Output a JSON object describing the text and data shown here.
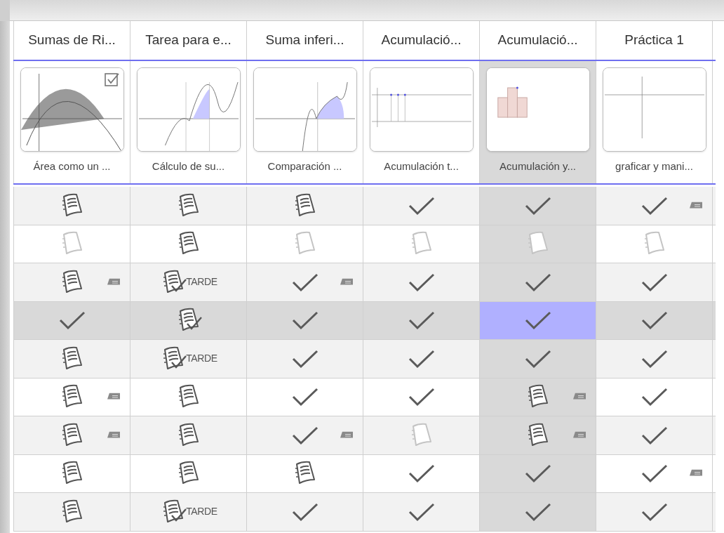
{
  "columns": [
    {
      "title": "Sumas de Ri...",
      "subtitle": "Área como un ...",
      "checked": true,
      "selected": false
    },
    {
      "title": "Tarea para e...",
      "subtitle": "Cálculo de su...",
      "checked": false,
      "selected": false
    },
    {
      "title": "Suma inferi...",
      "subtitle": "Comparación ...",
      "checked": false,
      "selected": false
    },
    {
      "title": "Acumulació...",
      "subtitle": "Acumulación t...",
      "checked": false,
      "selected": false
    },
    {
      "title": "Acumulació...",
      "subtitle": "Acumulación y...",
      "checked": false,
      "selected": true
    },
    {
      "title": "Práctica 1",
      "subtitle": "graficar y mani...",
      "checked": false,
      "selected": false
    }
  ],
  "rows": [
    {
      "selected": false,
      "cells": [
        {
          "kind": "notes",
          "comment": false,
          "selected": false
        },
        {
          "kind": "notes",
          "comment": false,
          "selected": false
        },
        {
          "kind": "notes",
          "comment": false,
          "selected": false
        },
        {
          "kind": "check",
          "comment": false,
          "selected": false
        },
        {
          "kind": "check",
          "comment": false,
          "selected": false
        },
        {
          "kind": "check",
          "comment": true,
          "selected": false
        }
      ]
    },
    {
      "selected": false,
      "cells": [
        {
          "kind": "empty",
          "comment": false,
          "selected": false
        },
        {
          "kind": "notes",
          "comment": false,
          "selected": false
        },
        {
          "kind": "empty",
          "comment": false,
          "selected": false
        },
        {
          "kind": "empty",
          "comment": false,
          "selected": false
        },
        {
          "kind": "empty",
          "comment": false,
          "selected": false
        },
        {
          "kind": "empty",
          "comment": false,
          "selected": false
        }
      ]
    },
    {
      "selected": false,
      "cells": [
        {
          "kind": "notes",
          "comment": true,
          "selected": false
        },
        {
          "kind": "submitted",
          "late": "TARDE",
          "comment": false,
          "selected": false
        },
        {
          "kind": "check",
          "comment": true,
          "selected": false
        },
        {
          "kind": "check",
          "comment": false,
          "selected": false
        },
        {
          "kind": "check",
          "comment": false,
          "selected": false
        },
        {
          "kind": "check",
          "comment": false,
          "selected": false
        }
      ]
    },
    {
      "selected": true,
      "cells": [
        {
          "kind": "check",
          "comment": false,
          "selected": false
        },
        {
          "kind": "submitted",
          "comment": false,
          "selected": false
        },
        {
          "kind": "check",
          "comment": false,
          "selected": false
        },
        {
          "kind": "check",
          "comment": false,
          "selected": false
        },
        {
          "kind": "check",
          "comment": false,
          "selected": true
        },
        {
          "kind": "check",
          "comment": false,
          "selected": false
        }
      ]
    },
    {
      "selected": false,
      "cells": [
        {
          "kind": "notes",
          "comment": false,
          "selected": false
        },
        {
          "kind": "submitted",
          "late": "TARDE",
          "comment": false,
          "selected": false
        },
        {
          "kind": "check",
          "comment": false,
          "selected": false
        },
        {
          "kind": "check",
          "comment": false,
          "selected": false
        },
        {
          "kind": "check",
          "comment": false,
          "selected": false
        },
        {
          "kind": "check",
          "comment": false,
          "selected": false
        }
      ]
    },
    {
      "selected": false,
      "cells": [
        {
          "kind": "notes",
          "comment": true,
          "selected": false
        },
        {
          "kind": "notes",
          "comment": false,
          "selected": false
        },
        {
          "kind": "check",
          "comment": false,
          "selected": false
        },
        {
          "kind": "check",
          "comment": false,
          "selected": false
        },
        {
          "kind": "notes",
          "comment": true,
          "selected": false
        },
        {
          "kind": "check",
          "comment": false,
          "selected": false
        }
      ]
    },
    {
      "selected": false,
      "cells": [
        {
          "kind": "notes",
          "comment": true,
          "selected": false
        },
        {
          "kind": "notes",
          "comment": false,
          "selected": false
        },
        {
          "kind": "check",
          "comment": true,
          "selected": false
        },
        {
          "kind": "empty",
          "comment": false,
          "selected": false
        },
        {
          "kind": "notes",
          "comment": true,
          "selected": false
        },
        {
          "kind": "check",
          "comment": false,
          "selected": false
        }
      ]
    },
    {
      "selected": false,
      "cells": [
        {
          "kind": "notes",
          "comment": false,
          "selected": false
        },
        {
          "kind": "notes",
          "comment": false,
          "selected": false
        },
        {
          "kind": "notes",
          "comment": false,
          "selected": false
        },
        {
          "kind": "check",
          "comment": false,
          "selected": false
        },
        {
          "kind": "check",
          "comment": false,
          "selected": false
        },
        {
          "kind": "check",
          "comment": true,
          "selected": false
        }
      ]
    },
    {
      "selected": false,
      "cells": [
        {
          "kind": "notes",
          "comment": false,
          "selected": false
        },
        {
          "kind": "submitted",
          "late": "TARDE",
          "comment": false,
          "selected": false
        },
        {
          "kind": "check",
          "comment": false,
          "selected": false
        },
        {
          "kind": "check",
          "comment": false,
          "selected": false
        },
        {
          "kind": "check",
          "comment": false,
          "selected": false
        },
        {
          "kind": "check",
          "comment": false,
          "selected": false
        }
      ]
    }
  ]
}
